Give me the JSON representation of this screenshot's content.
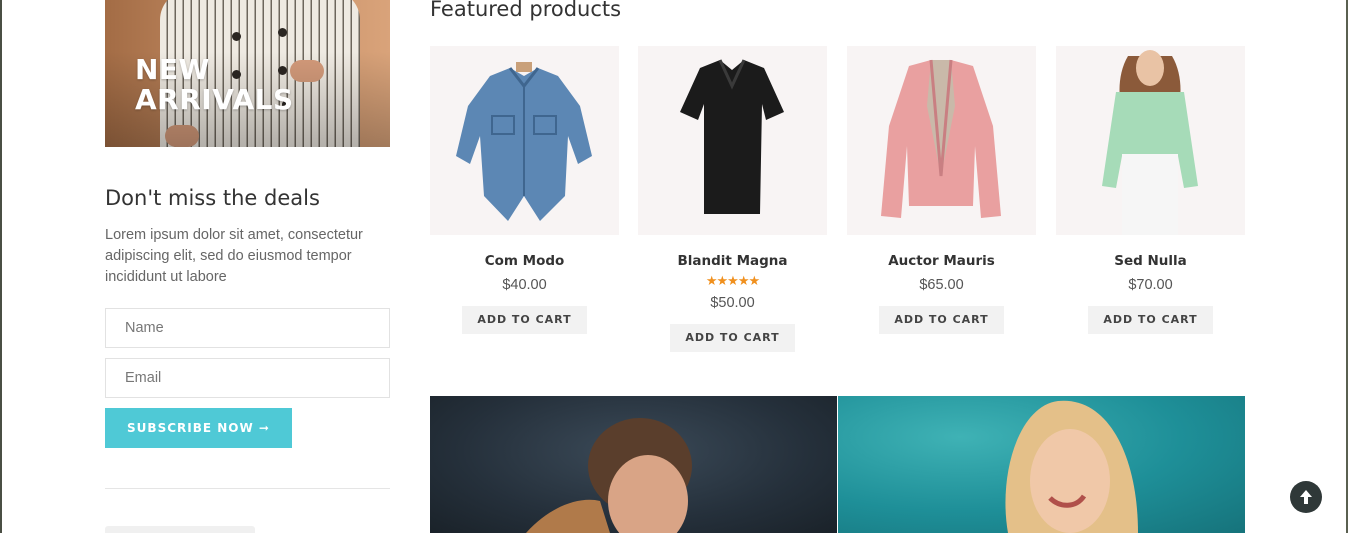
{
  "banner": {
    "title": "NEW ARRIVALS"
  },
  "deals": {
    "title": "Don't miss the deals",
    "text": "Lorem ipsum dolor sit amet, consectetur adipiscing elit, sed do eiusmod tempor incididunt ut labore",
    "name_placeholder": "Name",
    "email_placeholder": "Email",
    "subscribe_label": "SUBSCRIBE NOW ➞"
  },
  "featured": {
    "title": "Featured products",
    "products": [
      {
        "name": "Com Modo",
        "price": "$40.00",
        "cart_label": "ADD TO CART",
        "image": "denim-shirt-image"
      },
      {
        "name": "Blandit Magna",
        "price": "$50.00",
        "cart_label": "ADD TO CART",
        "rating": 5,
        "stars": "★★★★★",
        "image": "black-polo-image"
      },
      {
        "name": "Auctor Mauris",
        "price": "$65.00",
        "cart_label": "ADD TO CART",
        "image": "pink-jacket-image"
      },
      {
        "name": "Sed Nulla",
        "price": "$70.00",
        "cart_label": "ADD TO CART",
        "image": "green-blouse-image"
      }
    ]
  },
  "colors": {
    "accent": "#4fc9d6",
    "star": "#f0901e",
    "scroll_button": "#2f3838"
  },
  "icons": {
    "scroll_top": "arrow-up-icon"
  }
}
